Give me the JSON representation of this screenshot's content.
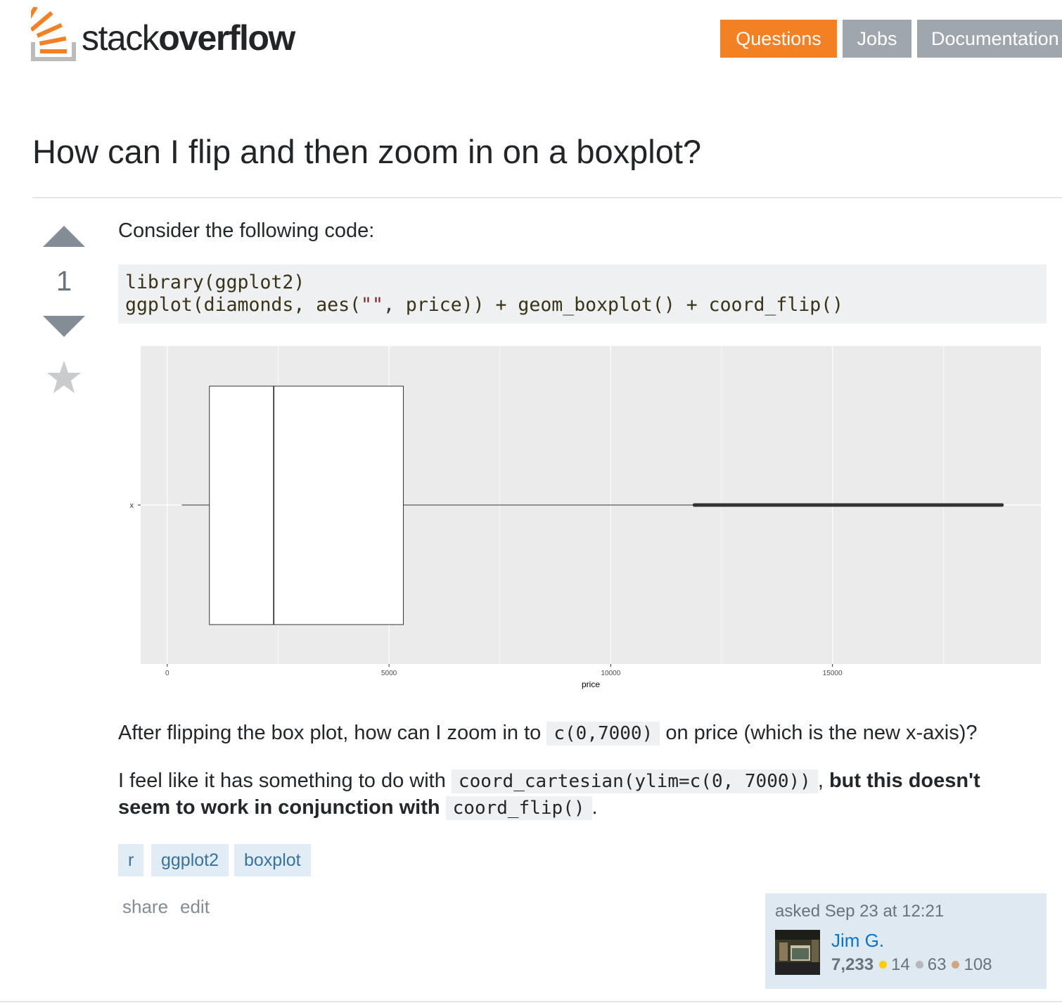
{
  "brand": {
    "word_light": "stack",
    "word_bold": "overflow"
  },
  "nav": {
    "questions": "Questions",
    "jobs": "Jobs",
    "documentation": "Documentation"
  },
  "question": {
    "title": "How can I flip and then zoom in on a boxplot?",
    "votes": "1",
    "intro": "Consider the following code:",
    "code_line1": "library(ggplot2)",
    "code_line2_a": "ggplot(diamonds, aes(",
    "code_line2_str": "\"\"",
    "code_line2_b": ", price)) + geom_boxplot() + coord_flip()",
    "p1_before": "After flipping the box plot, how can I zoom in to",
    "p1_code": "c(0,7000)",
    "p1_after": "on price (which is the new x-axis)?",
    "p2_before": "I feel like it has something to do with",
    "p2_code": "coord_cartesian(ylim=c(0, 7000))",
    "p2_sep": ",",
    "p2_bold": "but this doesn't",
    "p2_bold2": "seem to work in conjunction with",
    "p2_code2": "coord_flip()",
    "p2_end": "."
  },
  "tags": [
    "r",
    "ggplot2",
    "boxplot"
  ],
  "post_menu": {
    "share": "share",
    "edit": "edit"
  },
  "owner": {
    "asked": "asked Sep 23 at 12:21",
    "name": "Jim G.",
    "reputation": "7,233",
    "gold": "14",
    "silver": "63",
    "bronze": "108"
  },
  "colors": {
    "accent": "#f48024",
    "nav_gray": "#9fa6ad",
    "link": "#0077cc",
    "tag_bg": "#e1ecf4",
    "tag_text": "#39739d"
  },
  "chart_data": {
    "type": "boxplot",
    "orientation": "horizontal",
    "xlabel": "price",
    "ylabel": "",
    "category_tick": "x",
    "xlim": [
      -600,
      19700
    ],
    "x_ticks": [
      0,
      5000,
      10000,
      15000
    ],
    "box": {
      "whisker_low": 326,
      "q1": 950,
      "median": 2401,
      "q3": 5324,
      "whisker_high": 11886,
      "outlier_range": [
        11886,
        18823
      ]
    },
    "panel_background": "#ebebeb",
    "grid": true
  }
}
